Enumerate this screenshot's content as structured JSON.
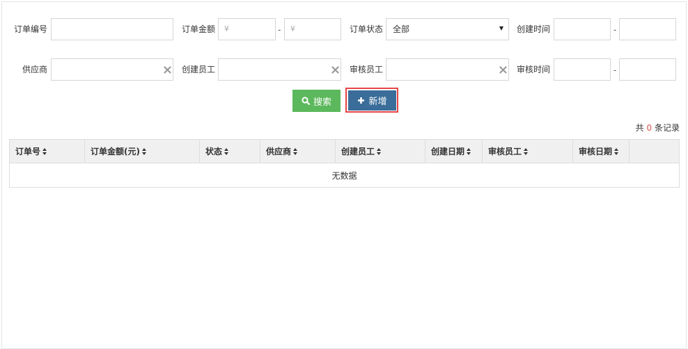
{
  "filters": {
    "order_no": {
      "label": "订单编号",
      "value": ""
    },
    "order_amount": {
      "label": "订单金额",
      "min_placeholder": "¥",
      "max_placeholder": "¥",
      "separator": "-"
    },
    "order_status": {
      "label": "订单状态",
      "selected": "全部"
    },
    "create_time": {
      "label": "创建时间",
      "separator": "-"
    },
    "supplier": {
      "label": "供应商",
      "value": ""
    },
    "creator": {
      "label": "创建员工",
      "value": ""
    },
    "reviewer": {
      "label": "审核员工",
      "value": ""
    },
    "review_time": {
      "label": "审核时间",
      "separator": "-"
    }
  },
  "actions": {
    "search_label": "搜索",
    "add_label": "新增"
  },
  "records": {
    "prefix": "共",
    "count": "0",
    "suffix": "条记录"
  },
  "table": {
    "columns": [
      "订单号",
      "订单金额(元)",
      "状态",
      "供应商",
      "创建员工",
      "创建日期",
      "审核员工",
      "审核日期",
      ""
    ],
    "empty_text": "无数据"
  },
  "colors": {
    "search_button": "#5cb85c",
    "add_button": "#3a6d99",
    "highlight_border": "#e54545",
    "record_count": "#d9534f"
  },
  "icons": {
    "search": "search-icon",
    "add": "plus-icon",
    "clear": "clear-icon",
    "sort": "sort-icon",
    "dropdown": "caret-down-icon"
  }
}
